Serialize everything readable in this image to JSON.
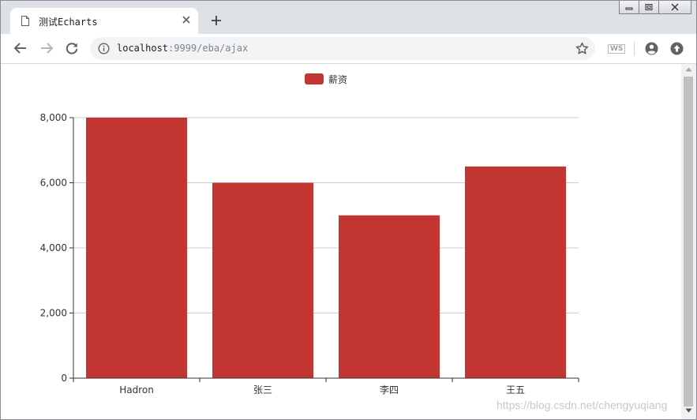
{
  "browser": {
    "tab_title": "测试Echarts",
    "url_host": "localhost",
    "url_rest": ":9999/eba/ajax",
    "extension_label": "WS"
  },
  "colors": {
    "bar": "#c23531",
    "axis": "#333333",
    "grid": "#cccccc",
    "text": "#333333"
  },
  "chart_data": {
    "type": "bar",
    "categories": [
      "Hadron",
      "张三",
      "李四",
      "王五"
    ],
    "series": [
      {
        "name": "薪资",
        "values": [
          8000,
          6000,
          5000,
          6500
        ]
      }
    ],
    "ylim": [
      0,
      8000
    ],
    "yticks": [
      0,
      2000,
      4000,
      6000,
      8000
    ],
    "ytick_labels": [
      "0",
      "2,000",
      "4,000",
      "6,000",
      "8,000"
    ],
    "grid": true,
    "legend": "top-center"
  },
  "watermark": "https://blog.csdn.net/chengyuqiang"
}
